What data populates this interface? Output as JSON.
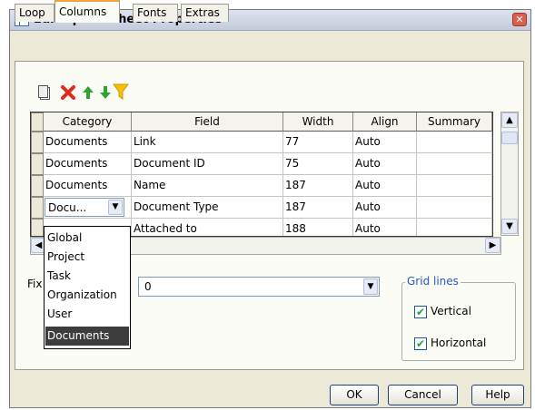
{
  "window": {
    "title": "Edit Spreadsheet Properties",
    "close_glyph": "✕"
  },
  "tabs": [
    {
      "label": "Loop"
    },
    {
      "label": "Columns"
    },
    {
      "label": "Fonts"
    },
    {
      "label": "Extras"
    }
  ],
  "toolbar": {
    "icons": [
      "new-column-icon",
      "delete-icon",
      "move-up-icon",
      "move-down-icon",
      "filter-icon"
    ],
    "colors": {
      "delete": "#e02b1e",
      "arrows": "#2ea62e",
      "filter": "#f2c200"
    }
  },
  "grid": {
    "columns": [
      "Category",
      "Field",
      "Width",
      "Align",
      "Summary"
    ],
    "rows": [
      {
        "category": "Documents",
        "field": "Link",
        "width": "77",
        "align": "Auto",
        "summary": ""
      },
      {
        "category": "Documents",
        "field": "Document ID",
        "width": "75",
        "align": "Auto",
        "summary": ""
      },
      {
        "category": "Documents",
        "field": "Name",
        "width": "187",
        "align": "Auto",
        "summary": ""
      },
      {
        "category": "Docu...",
        "field": "Document Type",
        "width": "187",
        "align": "Auto",
        "summary": ""
      },
      {
        "category": "",
        "field": "Attached to",
        "width": "188",
        "align": "Auto",
        "summary": ""
      }
    ]
  },
  "category_dropdown": {
    "options": [
      "Global",
      "Project",
      "Task",
      "Organization",
      "User",
      "Documents"
    ],
    "selected": "Documents"
  },
  "fixed": {
    "label_partial": "Fix",
    "value": "0"
  },
  "gridlines": {
    "legend": "Grid lines",
    "vertical": {
      "label": "Vertical",
      "checked": true
    },
    "horizontal": {
      "label": "Horizontal",
      "checked": true
    }
  },
  "buttons": {
    "ok": "OK",
    "cancel": "Cancel",
    "help": "Help"
  },
  "colors": {
    "accent_tab": "#f3a33c",
    "legend": "#2b56c5",
    "dropdown_selected": "#3d3d3d"
  }
}
